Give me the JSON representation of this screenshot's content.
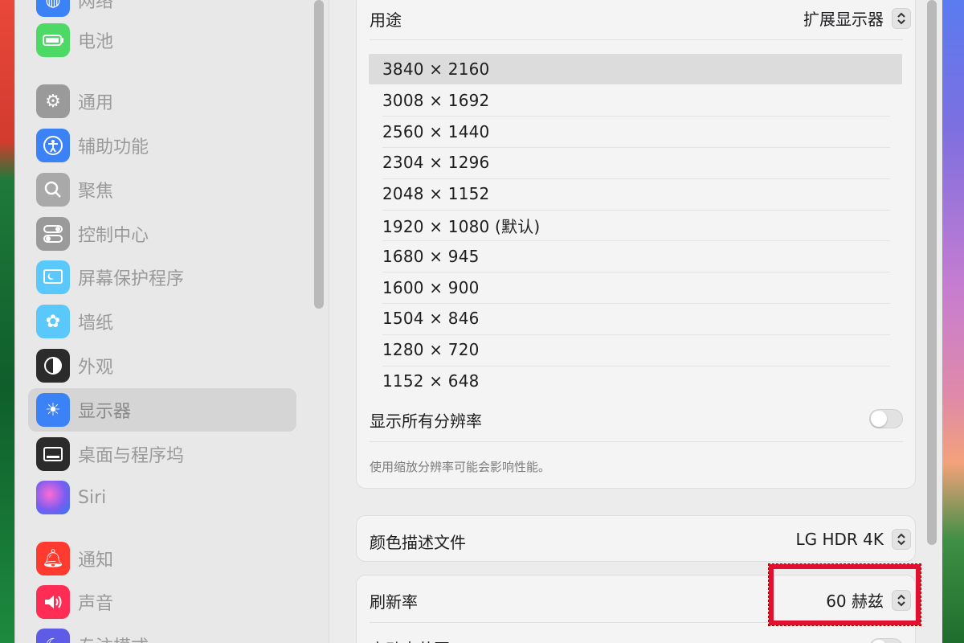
{
  "sidebar": {
    "items": [
      {
        "label": "网络",
        "icon": "globe-icon",
        "color": "#3b82f6"
      },
      {
        "label": "电池",
        "icon": "battery-icon",
        "color": "#4cd964"
      },
      {
        "label": "通用",
        "icon": "gear-icon",
        "color": "#9a9a9a"
      },
      {
        "label": "辅助功能",
        "icon": "accessibility-icon",
        "color": "#3b82f6"
      },
      {
        "label": "聚焦",
        "icon": "magnifier-icon",
        "color": "#9a9a9a"
      },
      {
        "label": "控制中心",
        "icon": "toggles-icon",
        "color": "#9a9a9a"
      },
      {
        "label": "屏幕保护程序",
        "icon": "screensaver-icon",
        "color": "#5ac8fa"
      },
      {
        "label": "墙纸",
        "icon": "flower-icon",
        "color": "#5ac8fa"
      },
      {
        "label": "外观",
        "icon": "appearance-icon",
        "color": "#2b2b2b"
      },
      {
        "label": "显示器",
        "icon": "sun-icon",
        "color": "#3b82f6"
      },
      {
        "label": "桌面与程序坞",
        "icon": "dock-icon",
        "color": "#2b2b2b"
      },
      {
        "label": "Siri",
        "icon": "siri-icon",
        "color": "#7b5cf0"
      },
      {
        "label": "通知",
        "icon": "bell-icon",
        "color": "#ff3b30"
      },
      {
        "label": "声音",
        "icon": "speaker-icon",
        "color": "#ff2d55"
      },
      {
        "label": "专注模式",
        "icon": "moon-icon",
        "color": "#5e5ce6"
      }
    ],
    "selected_index": 9
  },
  "display": {
    "usage_label": "用途",
    "usage_value": "扩展显示器",
    "resolutions": [
      "3840 × 2160",
      "3008 × 1692",
      "2560 × 1440",
      "2304 × 1296",
      "2048 × 1152",
      "1920 × 1080 (默认)",
      "1680 × 945",
      "1600 × 900",
      "1504 × 846",
      "1280 × 720",
      "1152 × 648"
    ],
    "selected_resolution_index": 0,
    "show_all_label": "显示所有分辨率",
    "show_all_enabled": false,
    "note": "使用缩放分辨率可能会影响性能。",
    "color_profile_label": "颜色描述文件",
    "color_profile_value": "LG HDR 4K",
    "refresh_label": "刷新率",
    "refresh_value": "60 赫兹",
    "partial_next_label": "高动态范围"
  },
  "colors": {
    "highlight": "#e0102e"
  }
}
